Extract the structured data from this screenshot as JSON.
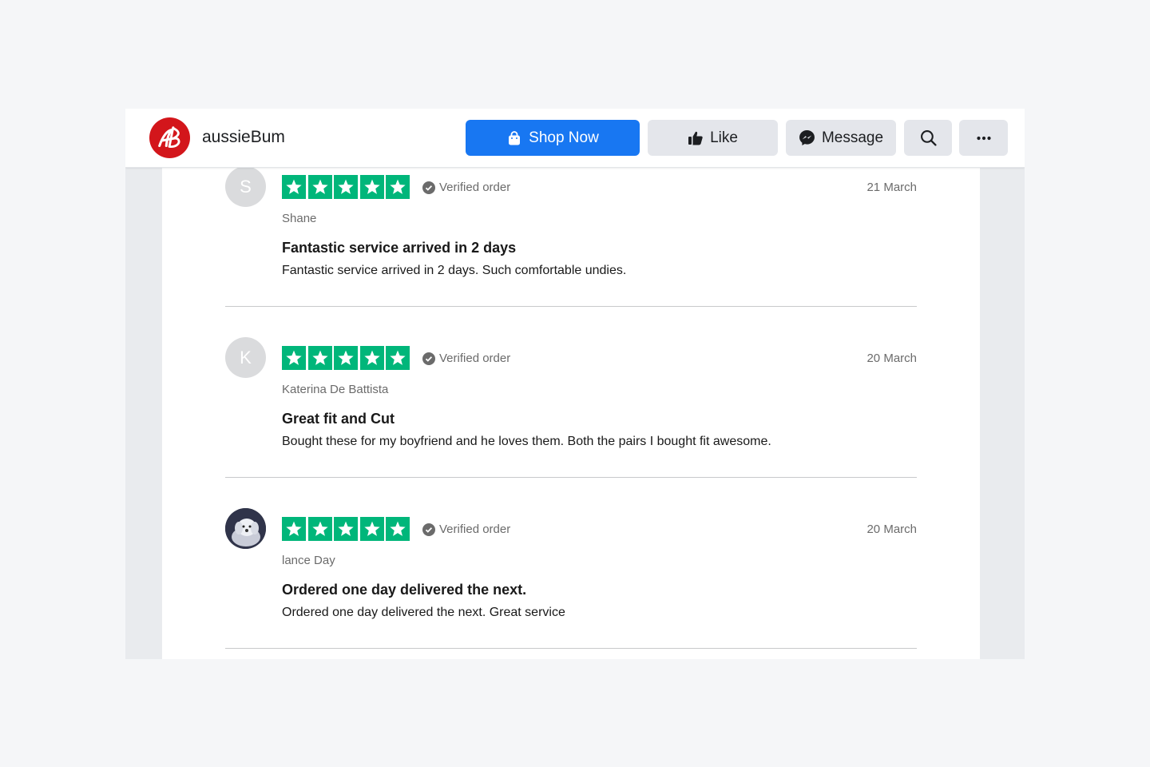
{
  "header": {
    "brand_name": "aussieBum",
    "shop_now_label": "Shop Now",
    "like_label": "Like",
    "message_label": "Message"
  },
  "colors": {
    "facebook_blue": "#1877f2",
    "trustpilot_green": "#00b67a",
    "logo_red": "#d3161b"
  },
  "reviews": [
    {
      "avatar_initial": "S",
      "rating": 5,
      "verified_label": "Verified order",
      "date": "21 March",
      "author": "Shane",
      "title": "Fantastic service arrived in 2 days",
      "body": "Fantastic service arrived in 2 days. Such comfortable undies."
    },
    {
      "avatar_initial": "K",
      "rating": 5,
      "verified_label": "Verified order",
      "date": "20 March",
      "author": "Katerina De Battista",
      "title": "Great fit and Cut",
      "body": "Bought these for my boyfriend and he loves them. Both the pairs I bought fit awesome."
    },
    {
      "avatar_initial": "",
      "rating": 5,
      "verified_label": "Verified order",
      "date": "20 March",
      "author": "lance Day",
      "title": "Ordered one day delivered the next.",
      "body": "Ordered one day delivered the next. Great service"
    }
  ]
}
